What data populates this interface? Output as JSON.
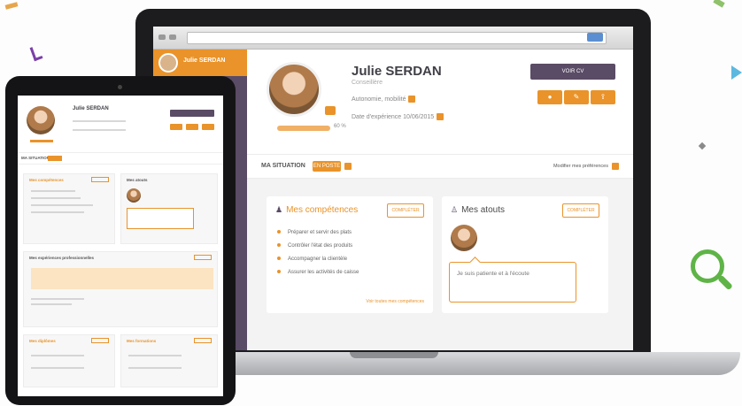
{
  "profile": {
    "name": "Julie SERDAN",
    "role": "Conseillère",
    "info_line_1": "Autonomie, mobilité",
    "info_line_2": "Date d'expérience 10/06/2015",
    "primary_button": "VOIR CV",
    "progress_text": "60 %"
  },
  "situation": {
    "label": "MA SITUATION",
    "status": "EN POSTE",
    "right_link": "Modifier mes préférences"
  },
  "competences": {
    "title": "Mes compétences",
    "button": "COMPLÉTER",
    "items": [
      "Préparer et servir des plats",
      "Contrôler l'état des produits",
      "Accompagner la clientèle",
      "Assurer les activités de caisse"
    ],
    "link": "Voir toutes mes compétences"
  },
  "atouts": {
    "title": "Mes atouts",
    "button": "COMPLÉTER",
    "quote": "Je suis patiente et à l'écoute"
  },
  "tablet": {
    "name": "Julie SERDAN",
    "situation_label": "MA SITUATION",
    "panels": [
      "Mes compétences",
      "Mes atouts",
      "Mes expériences professionnelles",
      "Mes diplômes",
      "Mes formations"
    ]
  },
  "colors": {
    "accent": "#e9932a",
    "purple": "#5a4b66",
    "green": "#5fb447"
  },
  "icons": [
    "magnifier-icon",
    "eye-icon",
    "edit-icon",
    "share-icon",
    "camera-icon",
    "user-icon",
    "star-icon"
  ]
}
